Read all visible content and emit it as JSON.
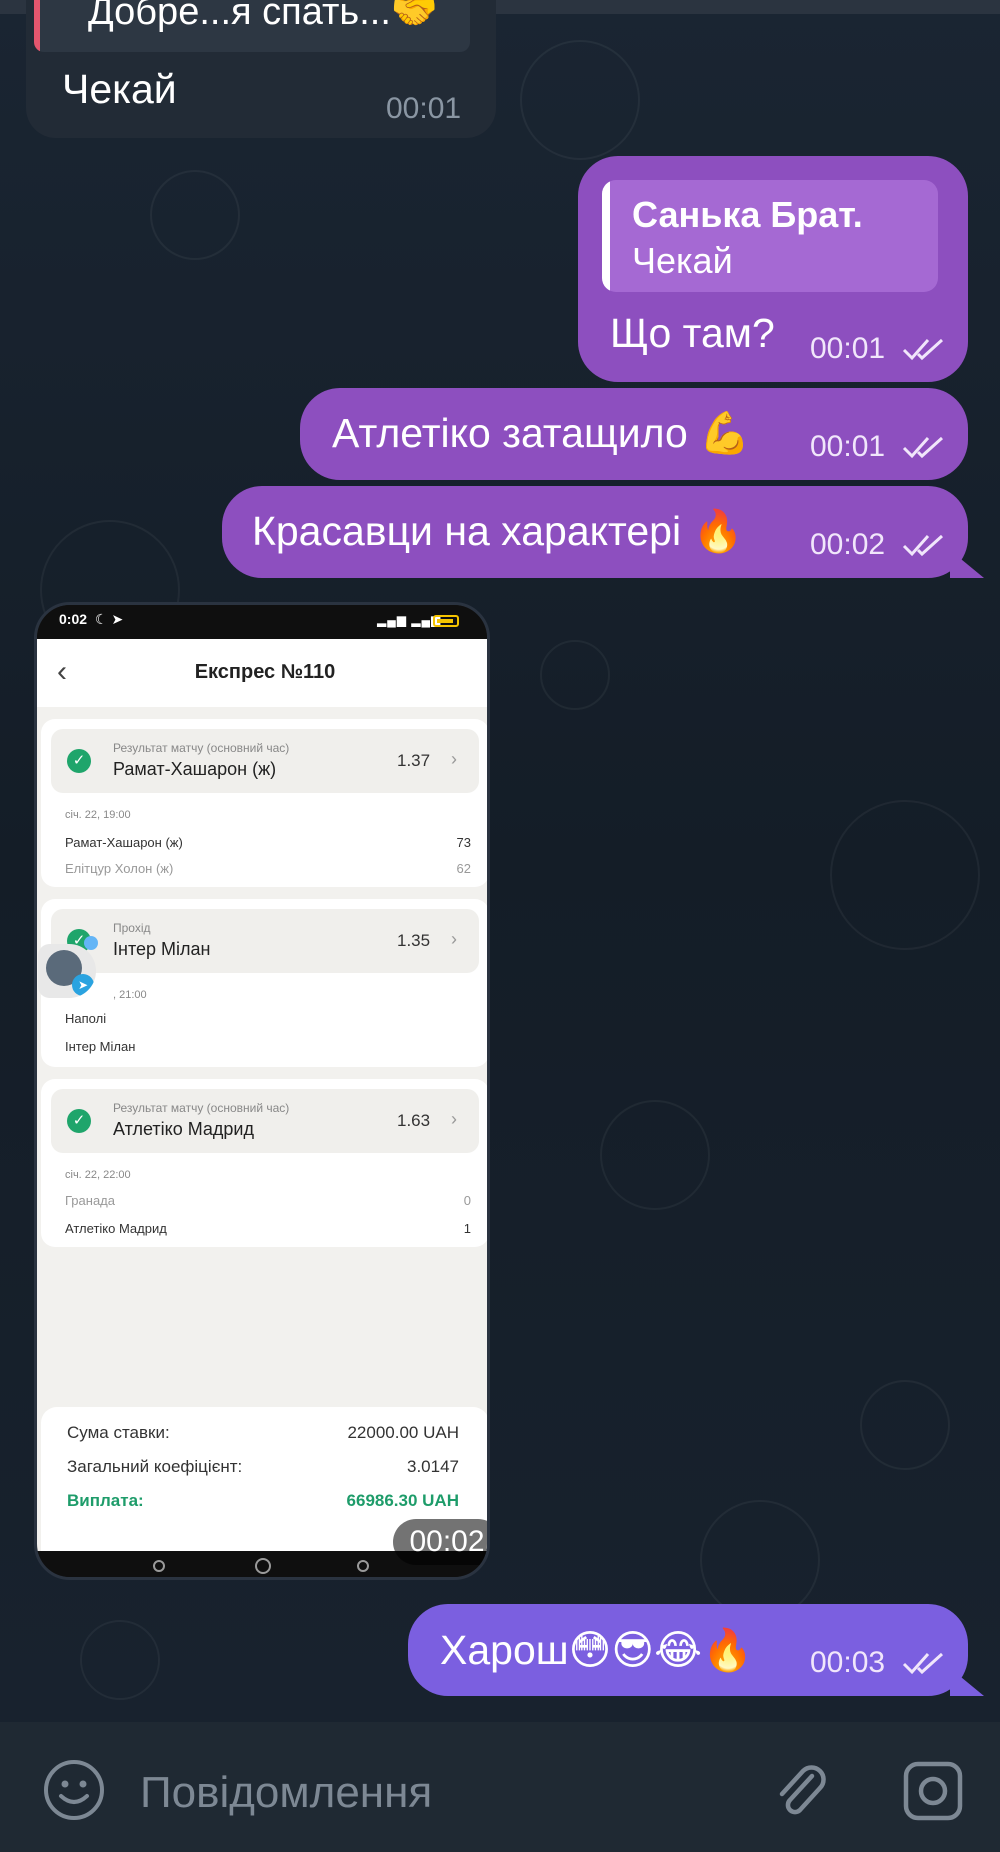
{
  "messages": {
    "incoming": {
      "reply_text": "Добре...я спать...🤝",
      "text": "Чекай",
      "time": "00:01"
    },
    "out1": {
      "quote_name": "Санька Брат.",
      "quote_text": "Чекай",
      "text": "Що там?",
      "time": "00:01"
    },
    "out2": {
      "text": "Атлетіко затащило 💪",
      "time": "00:01"
    },
    "out3": {
      "text": "Красавци на характері 🔥",
      "time": "00:02"
    },
    "photo_time": "00:02",
    "out4": {
      "text": "Харош😳😎😂🔥",
      "time": "00:03"
    }
  },
  "screenshot": {
    "status_time": "0:02",
    "title": "Експрес №110",
    "bets": [
      {
        "market": "Результат матчу (основний час)",
        "pick": "Рамат-Хашарон (ж)",
        "odds": "1.37",
        "date": "січ. 22, 19:00",
        "team1": "Рамат-Хашарон (ж)",
        "score1": "73",
        "team2": "Елітцур Холон (ж)",
        "score2": "62"
      },
      {
        "market": "Прохід",
        "pick": "Інтер Мілан",
        "odds": "1.35",
        "date": ", 21:00",
        "team1": "Наполі",
        "score1": "",
        "team2": "Інтер Мілан",
        "score2": ""
      },
      {
        "market": "Результат матчу (основний час)",
        "pick": "Атлетіко Мадрид",
        "odds": "1.63",
        "date": "січ. 22, 22:00",
        "team1": "Гранада",
        "score1": "0",
        "team2": "Атлетіко Мадрид",
        "score2": "1"
      }
    ],
    "summary": {
      "stake_label": "Сума ставки:",
      "stake_value": "22000.00 UAH",
      "coef_label": "Загальний коефіцієнт:",
      "coef_value": "3.0147",
      "payout_label": "Виплата:",
      "payout_value": "66986.30 UAH"
    }
  },
  "input": {
    "placeholder": "Повідомлення"
  },
  "colors": {
    "outgoing_bubble": "#8d4fbf",
    "outgoing_bubble_last": "#7b5fe0",
    "incoming_bubble": "#222b36",
    "background": "#16202b",
    "payout_green": "#1e9c6a"
  },
  "icons": [
    "emoji-icon",
    "attach-icon",
    "camera-icon",
    "double-check-icon"
  ]
}
